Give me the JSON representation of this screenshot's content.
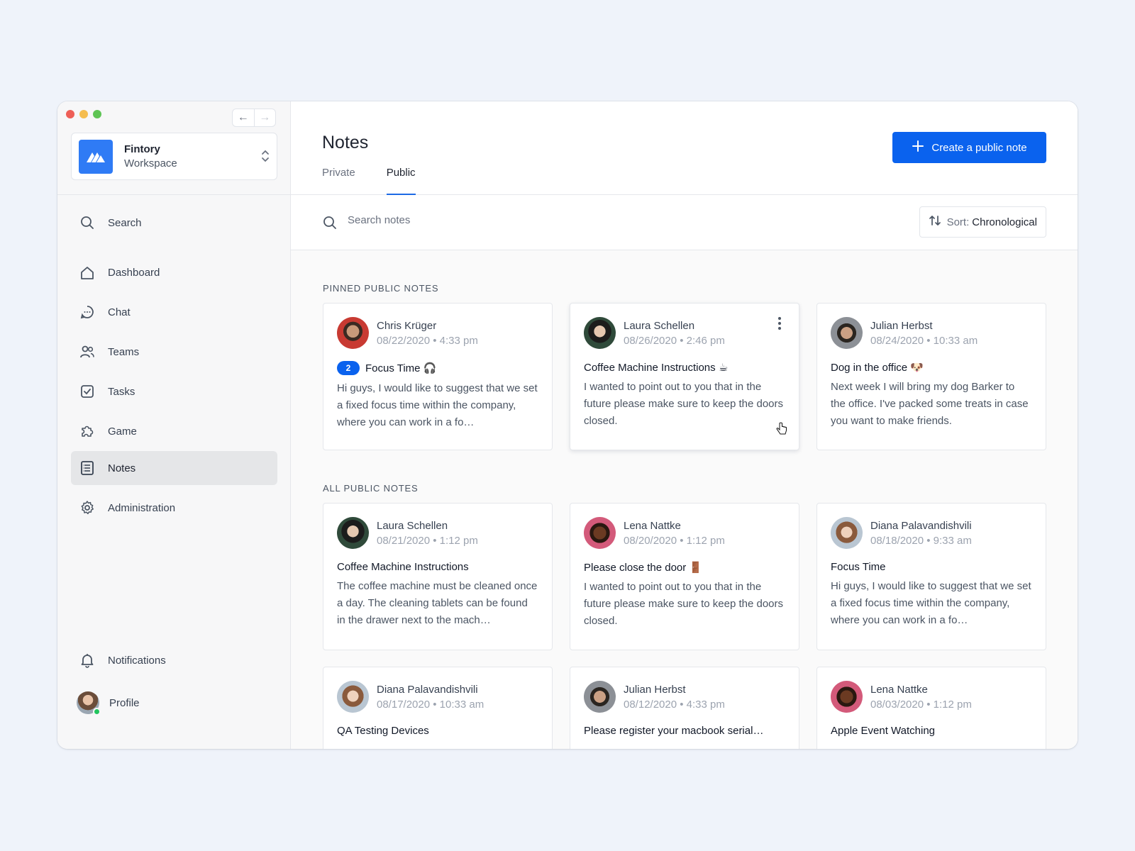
{
  "sidebar": {
    "workspace": {
      "name": "Fintory",
      "sub": "Workspace"
    },
    "nav": [
      {
        "label": "Search",
        "icon": "search-icon"
      },
      {
        "label": "Dashboard",
        "icon": "home-icon"
      },
      {
        "label": "Chat",
        "icon": "chat-icon"
      },
      {
        "label": "Teams",
        "icon": "users-icon"
      },
      {
        "label": "Tasks",
        "icon": "checkbox-icon"
      },
      {
        "label": "Game",
        "icon": "puzzle-icon"
      },
      {
        "label": "Notes",
        "icon": "notes-icon",
        "active": true
      },
      {
        "label": "Administration",
        "icon": "gear-icon"
      }
    ],
    "bottom": [
      {
        "label": "Notifications",
        "icon": "bell-icon"
      },
      {
        "label": "Profile",
        "icon": "avatar"
      }
    ]
  },
  "header": {
    "title": "Notes",
    "tabs": [
      {
        "label": "Private"
      },
      {
        "label": "Public",
        "active": true
      }
    ],
    "create_label": "Create a public note"
  },
  "search": {
    "placeholder": "Search notes",
    "value": ""
  },
  "sort": {
    "label": "Sort:",
    "value": "Chronological"
  },
  "pinned": {
    "heading": "PINNED PUBLIC NOTES",
    "notes": [
      {
        "author": "Chris Krüger",
        "date": "08/22/2020 • 4:33 pm",
        "badge": "2",
        "title": "Focus Time 🎧",
        "body": "Hi guys, I would like to suggest that we set a fixed focus time within the company, where you can work in a fo…"
      },
      {
        "author": "Laura Schellen",
        "date": "08/26/2020 • 2:46 pm",
        "title": "Coffee Machine Instructions ☕",
        "body": "I wanted to point out to you that in the future please make sure to keep the doors closed."
      },
      {
        "author": "Julian Herbst",
        "date": "08/24/2020 • 10:33 am",
        "title": "Dog in the office 🐶",
        "body": "Next week I will bring my dog Barker to the office. I've packed some treats in case you want to make friends."
      }
    ]
  },
  "all": {
    "heading": "ALL PUBLIC NOTES",
    "notes": [
      {
        "author": "Laura Schellen",
        "date": "08/21/2020 • 1:12 pm",
        "title": "Coffee Machine Instructions",
        "body": "The coffee machine must be cleaned once a day. The cleaning tablets can be found in the drawer next to the mach…"
      },
      {
        "author": "Lena Nattke",
        "date": "08/20/2020 • 1:12 pm",
        "title": "Please close the door 🚪",
        "body": "I wanted to point out to you that in the future please make sure to keep the doors closed."
      },
      {
        "author": "Diana Palavandishvili",
        "date": "08/18/2020 • 9:33 am",
        "title": "Focus Time",
        "body": "Hi guys, I would like to suggest that we set a fixed focus time within the company, where you can work in a fo…"
      },
      {
        "author": "Diana Palavandishvili",
        "date": "08/17/2020 • 10:33 am",
        "title": "QA Testing Devices",
        "body": ""
      },
      {
        "author": "Julian Herbst",
        "date": "08/12/2020 • 4:33 pm",
        "title": "Please register your macbook serial…",
        "body": ""
      },
      {
        "author": "Lena Nattke",
        "date": "08/03/2020 • 1:12 pm",
        "title": "Apple Event Watching",
        "body": ""
      }
    ]
  },
  "colors": {
    "accent": "#0a62ee",
    "background": "#eff3fa",
    "online": "#22c55e"
  }
}
